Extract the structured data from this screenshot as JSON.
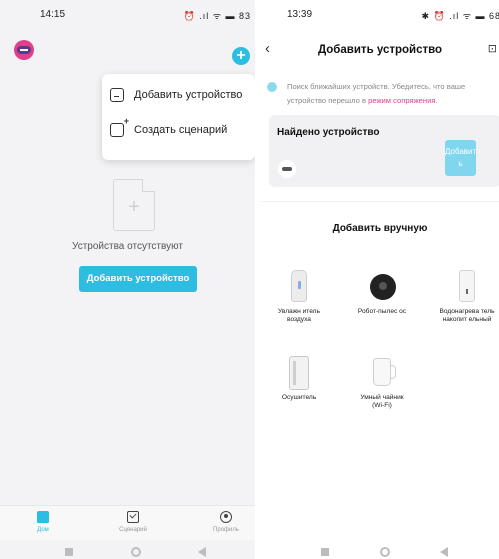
{
  "left": {
    "status": {
      "time": "14:15",
      "icons": "⏰ .ıl ᯤ ▬ 83"
    },
    "menu": {
      "add_device": "Добавить устройство",
      "create_scene": "Создать сценарий"
    },
    "empty_text": "Устройства отсутствуют",
    "add_device_button": "Добавить устройство",
    "tabs": [
      {
        "label": "Дом"
      },
      {
        "label": "Сценарий"
      },
      {
        "label": "Профиль"
      }
    ],
    "accent_color": "#2dbde3"
  },
  "right": {
    "status": {
      "time": "13:39",
      "icons": "✱ ⏰ .ıl ᯤ ▬ 68"
    },
    "title": "Добавить устройство",
    "back_icon": "‹",
    "scan_icon": "⊡",
    "hint_text": "Поиск ближайших устройств. Убедитесь, что ваше устройство перешло в ",
    "hint_link": "режим сопряжения",
    "hint_end": ".",
    "found_title": "Найдено устройство",
    "found_add_button": "Добавит ь",
    "manual_title": "Добавить вручную",
    "devices": [
      {
        "label": "Увлажн итель воздуха"
      },
      {
        "label": "Робот-пылес ос"
      },
      {
        "label": "Водонагрева тель накопит ельный"
      },
      {
        "label": "Осушитель"
      },
      {
        "label": "Умный чайник (Wi-Fi)"
      }
    ]
  }
}
